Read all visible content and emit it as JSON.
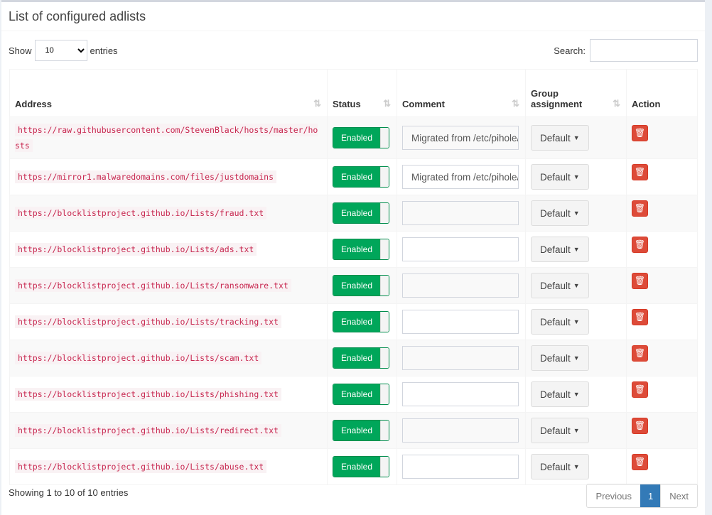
{
  "title": "List of configured adlists",
  "length": {
    "show": "Show",
    "value": "10",
    "entries": "entries"
  },
  "search": {
    "label": "Search:",
    "value": ""
  },
  "columns": [
    "Address",
    "Status",
    "Comment",
    "Group assignment",
    "Action"
  ],
  "sort_icon": "⇅",
  "rows": [
    {
      "address": "https://raw.githubusercontent.com/StevenBlack/hosts/master/hosts",
      "status": "Enabled",
      "comment": "Migrated from /etc/pihole/adlists.list",
      "group": "Default"
    },
    {
      "address": "https://mirror1.malwaredomains.com/files/justdomains",
      "status": "Enabled",
      "comment": "Migrated from /etc/pihole/adlists.list",
      "group": "Default"
    },
    {
      "address": "https://blocklistproject.github.io/Lists/fraud.txt",
      "status": "Enabled",
      "comment": "",
      "group": "Default"
    },
    {
      "address": "https://blocklistproject.github.io/Lists/ads.txt",
      "status": "Enabled",
      "comment": "",
      "group": "Default"
    },
    {
      "address": "https://blocklistproject.github.io/Lists/ransomware.txt",
      "status": "Enabled",
      "comment": "",
      "group": "Default"
    },
    {
      "address": "https://blocklistproject.github.io/Lists/tracking.txt",
      "status": "Enabled",
      "comment": "",
      "group": "Default"
    },
    {
      "address": "https://blocklistproject.github.io/Lists/scam.txt",
      "status": "Enabled",
      "comment": "",
      "group": "Default"
    },
    {
      "address": "https://blocklistproject.github.io/Lists/phishing.txt",
      "status": "Enabled",
      "comment": "",
      "group": "Default"
    },
    {
      "address": "https://blocklistproject.github.io/Lists/redirect.txt",
      "status": "Enabled",
      "comment": "",
      "group": "Default"
    },
    {
      "address": "https://blocklistproject.github.io/Lists/abuse.txt",
      "status": "Enabled",
      "comment": "",
      "group": "Default"
    }
  ],
  "info": "Showing 1 to 10 of 10 entries",
  "pagination": {
    "previous": "Previous",
    "current": "1",
    "next": "Next"
  },
  "colors": {
    "enabled": "#00a65a",
    "delete": "#dd4b39",
    "active_page": "#337ab7",
    "address": "#c7254e"
  }
}
